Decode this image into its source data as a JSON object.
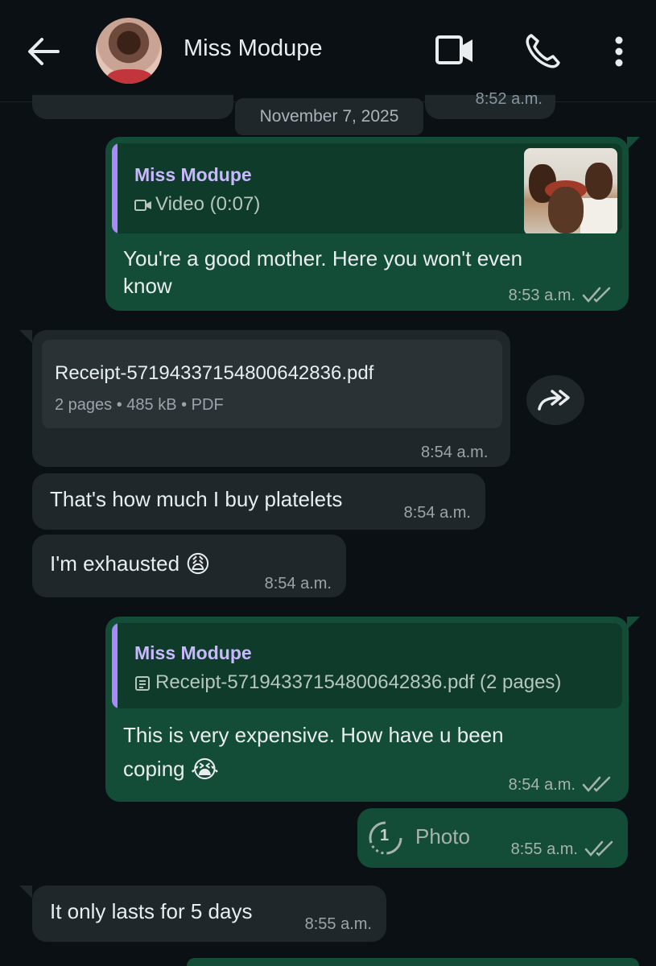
{
  "header": {
    "contact_name": "Miss Modupe",
    "icons": [
      "back-arrow-icon",
      "video-call-icon",
      "voice-call-icon",
      "more-vert-icon"
    ]
  },
  "partial_top": {
    "time": "8:52 a.m."
  },
  "date_chip": "November 7, 2025",
  "messages": [
    {
      "direction": "out",
      "quote": {
        "name": "Miss Modupe",
        "sub": "Video (0:07)",
        "type": "video"
      },
      "text": "You're a good mother. Here you won't even know",
      "time": "8:53 a.m."
    },
    {
      "direction": "in",
      "document": {
        "name": "Receipt-57194337154800642836.pdf",
        "meta": "2 pages • 485 kB • PDF"
      },
      "time": "8:54 a.m."
    },
    {
      "direction": "in",
      "text": "That's how much I buy platelets",
      "time": "8:54 a.m."
    },
    {
      "direction": "in",
      "text": "I'm exhausted",
      "emoji": "😩",
      "time": "8:54 a.m."
    },
    {
      "direction": "out",
      "quote": {
        "name": "Miss Modupe",
        "sub": "Receipt-57194337154800642836.pdf (2 pages)",
        "type": "document"
      },
      "text_line1": "This is very expensive.  How have u been",
      "text_line2": "coping",
      "emoji": "😭",
      "time": "8:54 a.m."
    },
    {
      "direction": "out",
      "view_once": "1",
      "text": "Photo",
      "time": "8:55 a.m."
    },
    {
      "direction": "in",
      "text": "It only lasts for 5 days",
      "time": "8:55 a.m."
    }
  ],
  "colors": {
    "background": "#0b1014",
    "outgoing_bubble": "#144d37",
    "incoming_bubble": "#1f272a",
    "quote_bar": "#a78bfa",
    "quote_name": "#c9b8ff"
  }
}
